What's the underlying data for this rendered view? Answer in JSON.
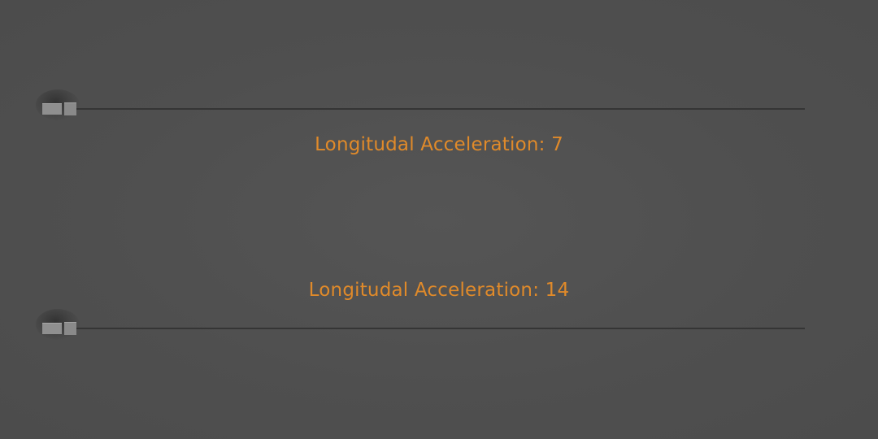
{
  "lanes": [
    {
      "label": "Longitudal Acceleration: 7",
      "vehicle_icon": "truck-icon"
    },
    {
      "label": "Longitudal Acceleration: 14",
      "vehicle_icon": "truck-icon"
    }
  ],
  "colors": {
    "background": "#4f4f4f",
    "track": "#353535",
    "label": "#e08a2a",
    "vehicle": "#8f8f8f"
  }
}
